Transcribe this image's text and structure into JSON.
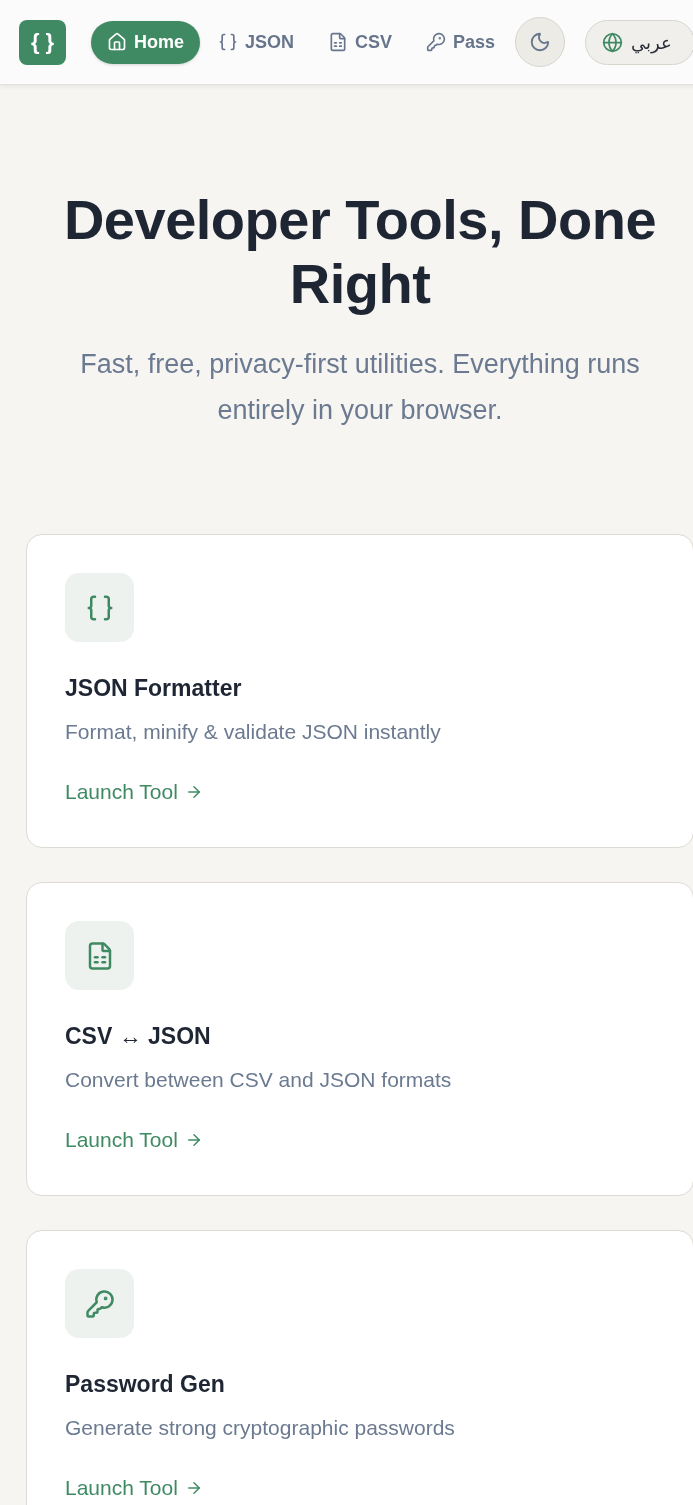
{
  "nav": {
    "logo": "{ }",
    "items": [
      {
        "kind": "home",
        "label": "Home",
        "selected": true
      },
      {
        "kind": "json",
        "label": "JSON",
        "selected": false
      },
      {
        "kind": "csv",
        "label": "CSV",
        "selected": false
      },
      {
        "kind": "pass",
        "label": "Pass",
        "selected": false
      }
    ],
    "language": "عربي"
  },
  "hero": {
    "title": "Developer Tools, Done Right",
    "subtitle": "Fast, free, privacy-first utilities. Everything runs entirely in your browser."
  },
  "tools": [
    {
      "kind": "json",
      "title": "JSON Formatter",
      "description": "Format, minify & validate JSON instantly",
      "link": "Launch Tool"
    },
    {
      "kind": "csv",
      "title": "CSV ↔ JSON",
      "description": "Convert between CSV and JSON formats",
      "link": "Launch Tool"
    },
    {
      "kind": "pass",
      "title": "Password Gen",
      "description": "Generate strong cryptographic passwords",
      "link": "Launch Tool"
    }
  ]
}
